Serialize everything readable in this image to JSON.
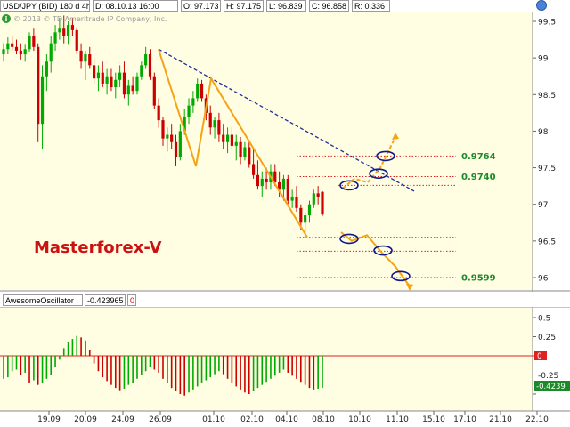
{
  "header": {
    "symbol": "USD/JPY (BID) 180 d 4h",
    "fields": [
      "D: 08.10.13 16:00",
      "O: 97.173",
      "H: 97.175",
      "L: 96.839",
      "C: 96.858",
      "R: 0.336"
    ]
  },
  "copyright": "© 2013 © TD Ameritrade IP Company, Inc.",
  "watermark": "Masterforex-V",
  "indicator": {
    "name": "AwesomeOscillator",
    "value": "-0.423965",
    "param": "0",
    "current_label": "-0.4239"
  },
  "colors": {
    "background": "#fffde2",
    "up_candle": "#00aa00",
    "down_candle": "#cc0000",
    "trendline": "#1f2e99",
    "pattern": "#f5a317",
    "fib_level": "#dd2222",
    "fib_label": "#1c8a2a",
    "watermark": "#cc1111"
  },
  "chart_data": {
    "type": "candlestick",
    "y_ticks": [
      "99.5",
      "99",
      "98.5",
      "98",
      "97.5",
      "97",
      "96.5",
      "96"
    ],
    "y_range": [
      95.9,
      99.6
    ],
    "x_ticks": [
      "19.09",
      "20.09",
      "24.09",
      "26.09",
      "01.10",
      "02.10",
      "04.10",
      "08.10",
      "10.10",
      "11.10",
      "15.10",
      "17.10",
      "21.10",
      "22.10"
    ],
    "candles_ohlc": [
      [
        99.05,
        99.2,
        98.95,
        99.12
      ],
      [
        99.12,
        99.28,
        99.05,
        99.2
      ],
      [
        99.2,
        99.3,
        99.1,
        99.15
      ],
      [
        99.15,
        99.25,
        99.05,
        99.1
      ],
      [
        99.1,
        99.2,
        98.98,
        99.05
      ],
      [
        99.05,
        99.18,
        98.95,
        99.12
      ],
      [
        99.12,
        99.35,
        99.08,
        99.3
      ],
      [
        99.3,
        99.4,
        99.1,
        99.15
      ],
      [
        99.15,
        99.2,
        97.85,
        98.1
      ],
      [
        98.1,
        98.9,
        97.75,
        98.75
      ],
      [
        98.75,
        99.05,
        98.55,
        98.95
      ],
      [
        98.95,
        99.3,
        98.8,
        99.2
      ],
      [
        99.2,
        99.45,
        99.1,
        99.35
      ],
      [
        99.35,
        99.55,
        99.25,
        99.4
      ],
      [
        99.4,
        99.58,
        99.2,
        99.3
      ],
      [
        99.3,
        99.5,
        99.18,
        99.45
      ],
      [
        99.45,
        99.55,
        99.3,
        99.38
      ],
      [
        99.38,
        99.42,
        99.05,
        99.1
      ],
      [
        99.1,
        99.2,
        98.85,
        98.95
      ],
      [
        98.95,
        99.1,
        98.7,
        99.05
      ],
      [
        99.05,
        99.15,
        98.85,
        98.9
      ],
      [
        98.9,
        99.0,
        98.65,
        98.72
      ],
      [
        98.72,
        98.9,
        98.55,
        98.8
      ],
      [
        98.8,
        98.95,
        98.6,
        98.65
      ],
      [
        98.65,
        98.85,
        98.5,
        98.75
      ],
      [
        98.75,
        98.85,
        98.55,
        98.6
      ],
      [
        98.6,
        98.8,
        98.45,
        98.7
      ],
      [
        98.7,
        98.9,
        98.6,
        98.8
      ],
      [
        98.8,
        98.95,
        98.45,
        98.5
      ],
      [
        98.5,
        98.7,
        98.35,
        98.62
      ],
      [
        98.62,
        98.75,
        98.5,
        98.55
      ],
      [
        98.55,
        98.8,
        98.5,
        98.75
      ],
      [
        98.75,
        98.95,
        98.7,
        98.9
      ],
      [
        98.9,
        99.15,
        98.85,
        99.05
      ],
      [
        99.05,
        99.12,
        98.7,
        98.75
      ],
      [
        98.75,
        98.8,
        98.3,
        98.35
      ],
      [
        98.35,
        98.45,
        98.05,
        98.15
      ],
      [
        98.15,
        98.2,
        97.8,
        97.9
      ],
      [
        97.9,
        98.05,
        97.72,
        97.95
      ],
      [
        97.95,
        98.1,
        97.75,
        97.85
      ],
      [
        97.85,
        97.95,
        97.52,
        97.65
      ],
      [
        97.65,
        98.1,
        97.6,
        98.0
      ],
      [
        98.0,
        98.3,
        97.95,
        98.2
      ],
      [
        98.2,
        98.45,
        98.1,
        98.35
      ],
      [
        98.35,
        98.55,
        98.25,
        98.45
      ],
      [
        98.45,
        98.72,
        98.4,
        98.65
      ],
      [
        98.65,
        98.7,
        98.4,
        98.45
      ],
      [
        98.45,
        98.5,
        98.15,
        98.25
      ],
      [
        98.25,
        98.35,
        97.95,
        98.05
      ],
      [
        98.05,
        98.2,
        97.9,
        98.15
      ],
      [
        98.15,
        98.25,
        97.85,
        97.95
      ],
      [
        97.95,
        98.1,
        97.75,
        97.85
      ],
      [
        97.85,
        98.05,
        97.7,
        97.95
      ],
      [
        97.95,
        98.05,
        97.75,
        97.8
      ],
      [
        97.8,
        97.95,
        97.6,
        97.85
      ],
      [
        97.85,
        97.92,
        97.55,
        97.65
      ],
      [
        97.65,
        97.85,
        97.6,
        97.78
      ],
      [
        97.78,
        97.85,
        97.5,
        97.55
      ],
      [
        97.55,
        97.75,
        97.35,
        97.4
      ],
      [
        97.4,
        97.6,
        97.2,
        97.25
      ],
      [
        97.25,
        97.45,
        97.1,
        97.35
      ],
      [
        97.35,
        97.5,
        97.2,
        97.3
      ],
      [
        97.3,
        97.55,
        97.2,
        97.45
      ],
      [
        97.45,
        97.55,
        97.25,
        97.3
      ],
      [
        97.3,
        97.45,
        97.1,
        97.2
      ],
      [
        97.2,
        97.4,
        97.05,
        97.35
      ],
      [
        97.35,
        97.4,
        97.0,
        97.05
      ],
      [
        97.05,
        97.2,
        96.95,
        97.1
      ],
      [
        97.1,
        97.25,
        96.9,
        96.95
      ],
      [
        96.95,
        97.0,
        96.65,
        96.75
      ],
      [
        96.75,
        96.9,
        96.55,
        96.85
      ],
      [
        96.85,
        97.05,
        96.75,
        97.0
      ],
      [
        97.0,
        97.2,
        96.95,
        97.15
      ],
      [
        97.15,
        97.25,
        97.0,
        97.1
      ],
      [
        97.17,
        97.18,
        96.84,
        96.86
      ]
    ],
    "trendline_points": [
      [
        178,
        98.12
      ],
      [
        465,
        97.18
      ]
    ],
    "pattern_path": [
      [
        178,
        99.12
      ],
      [
        220,
        97.52
      ],
      [
        237,
        98.72
      ],
      [
        345,
        96.55
      ]
    ],
    "projection_up": [
      [
        385,
        97.22
      ],
      [
        398,
        97.35
      ],
      [
        413,
        97.3
      ],
      [
        427,
        97.5
      ],
      [
        444,
        97.92
      ]
    ],
    "projection_down": [
      [
        383,
        96.62
      ],
      [
        395,
        96.5
      ],
      [
        412,
        96.58
      ],
      [
        428,
        96.35
      ],
      [
        444,
        96.15
      ],
      [
        460,
        95.88
      ]
    ],
    "levels": [
      {
        "price": 97.66,
        "x_start": 333,
        "label": "0.9764"
      },
      {
        "price": 97.38,
        "x_start": 333,
        "label": "0.9740"
      },
      {
        "price": 97.26,
        "x_start": 380,
        "label": ""
      },
      {
        "price": 96.55,
        "x_start": 333,
        "label": ""
      },
      {
        "price": 96.36,
        "x_start": 333,
        "label": ""
      },
      {
        "price": 96.0,
        "x_start": 333,
        "label": "0.9599"
      }
    ],
    "ellipses": [
      [
        433,
        97.66
      ],
      [
        425,
        97.42
      ],
      [
        392,
        97.26
      ],
      [
        392,
        96.53
      ],
      [
        430,
        96.37
      ],
      [
        450,
        96.02
      ]
    ],
    "oscillator": {
      "y_ticks": [
        "0.5",
        "0.25",
        "0",
        "-0.25",
        "-0.5"
      ],
      "y_range": [
        -0.55,
        0.55
      ],
      "values": [
        -0.3,
        -0.28,
        -0.2,
        -0.18,
        -0.25,
        -0.22,
        -0.35,
        -0.32,
        -0.38,
        -0.35,
        -0.3,
        -0.25,
        -0.15,
        -0.05,
        0.1,
        0.18,
        0.22,
        0.26,
        0.24,
        0.2,
        0.08,
        -0.1,
        -0.2,
        -0.28,
        -0.33,
        -0.38,
        -0.42,
        -0.45,
        -0.43,
        -0.38,
        -0.35,
        -0.3,
        -0.25,
        -0.2,
        -0.15,
        -0.18,
        -0.22,
        -0.3,
        -0.36,
        -0.42,
        -0.46,
        -0.5,
        -0.52,
        -0.48,
        -0.44,
        -0.4,
        -0.36,
        -0.32,
        -0.28,
        -0.24,
        -0.2,
        -0.24,
        -0.3,
        -0.36,
        -0.4,
        -0.44,
        -0.48,
        -0.5,
        -0.46,
        -0.42,
        -0.38,
        -0.34,
        -0.3,
        -0.26,
        -0.22,
        -0.18,
        -0.22,
        -0.26,
        -0.3,
        -0.34,
        -0.38,
        -0.42,
        -0.44,
        -0.43,
        -0.42
      ]
    }
  }
}
